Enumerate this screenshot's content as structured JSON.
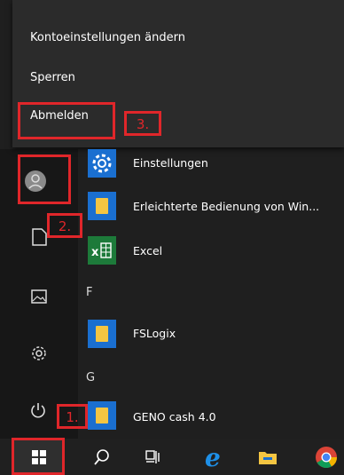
{
  "flyout": {
    "items": [
      {
        "label": "Kontoeinstellungen ändern"
      },
      {
        "label": "Sperren"
      },
      {
        "label": "Abmelden"
      }
    ]
  },
  "apps": [
    {
      "label": "Einstellungen"
    },
    {
      "label": "Erleichterte Bedienung von Win..."
    },
    {
      "label": "Excel"
    },
    {
      "label": "FSLogix"
    },
    {
      "label": "GENO cash 4.0"
    }
  ],
  "letters": {
    "f": "F",
    "g": "G"
  },
  "annotations": {
    "step1": "1.",
    "step2": "2.",
    "step3": "3."
  },
  "taskbar": {
    "icons": [
      "start-icon",
      "search-icon",
      "task-view-icon",
      "edge-icon",
      "file-explorer-icon",
      "chrome-icon"
    ]
  },
  "colors": {
    "annotation": "#e0262a",
    "tile_blue": "#1a6fd0",
    "tile_green": "#1d7a3a",
    "folder": "#f4c542"
  }
}
